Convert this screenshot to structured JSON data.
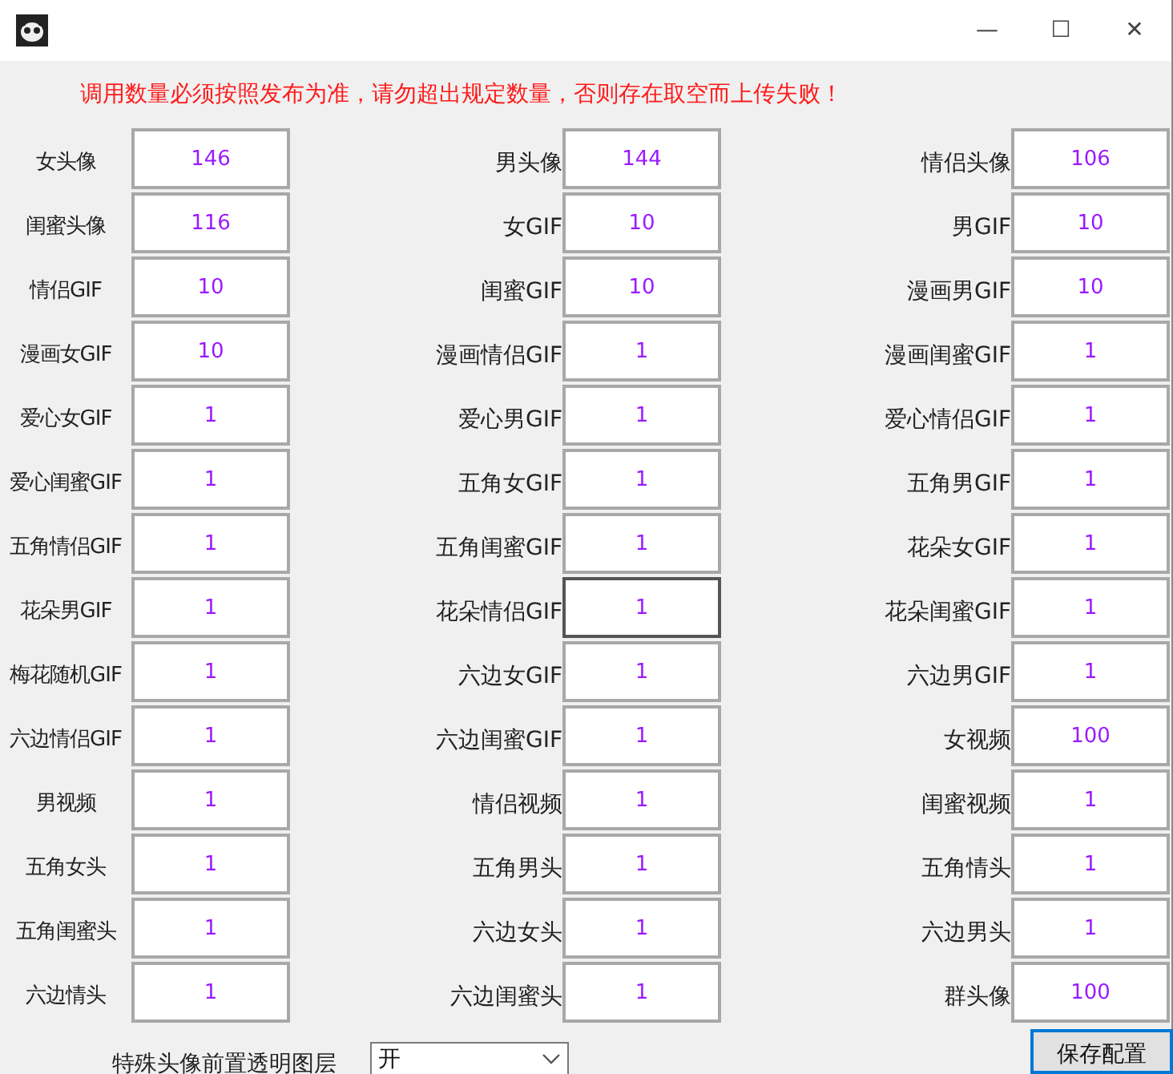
{
  "window": {
    "controls": [
      "—",
      "☐",
      "✕"
    ]
  },
  "notice": "调用数量必须按照发布为准，请勿超出规定数量，否则存在取空而上传失败！",
  "fields": [
    {
      "label": "女头像",
      "value": "146",
      "focused": false
    },
    {
      "label": "男头像",
      "value": "144",
      "focused": false
    },
    {
      "label": "情侣头像",
      "value": "106",
      "focused": false
    },
    {
      "label": "闺蜜头像",
      "value": "116",
      "focused": false
    },
    {
      "label": "女GIF",
      "value": "10",
      "focused": false
    },
    {
      "label": "男GIF",
      "value": "10",
      "focused": false
    },
    {
      "label": "情侣GIF",
      "value": "10",
      "focused": false
    },
    {
      "label": "闺蜜GIF",
      "value": "10",
      "focused": false
    },
    {
      "label": "漫画男GIF",
      "value": "10",
      "focused": false
    },
    {
      "label": "漫画女GIF",
      "value": "10",
      "focused": false
    },
    {
      "label": "漫画情侣GIF",
      "value": "1",
      "focused": false
    },
    {
      "label": "漫画闺蜜GIF",
      "value": "1",
      "focused": false
    },
    {
      "label": "爱心女GIF",
      "value": "1",
      "focused": false
    },
    {
      "label": "爱心男GIF",
      "value": "1",
      "focused": false
    },
    {
      "label": "爱心情侣GIF",
      "value": "1",
      "focused": false
    },
    {
      "label": "爱心闺蜜GIF",
      "value": "1",
      "focused": false
    },
    {
      "label": "五角女GIF",
      "value": "1",
      "focused": false
    },
    {
      "label": "五角男GIF",
      "value": "1",
      "focused": false
    },
    {
      "label": "五角情侣GIF",
      "value": "1",
      "focused": false
    },
    {
      "label": "五角闺蜜GIF",
      "value": "1",
      "focused": false
    },
    {
      "label": "花朵女GIF",
      "value": "1",
      "focused": false
    },
    {
      "label": "花朵男GIF",
      "value": "1",
      "focused": false
    },
    {
      "label": "花朵情侣GIF",
      "value": "1",
      "focused": true
    },
    {
      "label": "花朵闺蜜GIF",
      "value": "1",
      "focused": false
    },
    {
      "label": "梅花随机GIF",
      "value": "1",
      "focused": false
    },
    {
      "label": "六边女GIF",
      "value": "1",
      "focused": false
    },
    {
      "label": "六边男GIF",
      "value": "1",
      "focused": false
    },
    {
      "label": "六边情侣GIF",
      "value": "1",
      "focused": false
    },
    {
      "label": "六边闺蜜GIF",
      "value": "1",
      "focused": false
    },
    {
      "label": "女视频",
      "value": "100",
      "focused": false
    },
    {
      "label": "男视频",
      "value": "1",
      "focused": false
    },
    {
      "label": "情侣视频",
      "value": "1",
      "focused": false
    },
    {
      "label": "闺蜜视频",
      "value": "1",
      "focused": false
    },
    {
      "label": "五角女头",
      "value": "1",
      "focused": false
    },
    {
      "label": "五角男头",
      "value": "1",
      "focused": false
    },
    {
      "label": "五角情头",
      "value": "1",
      "focused": false
    },
    {
      "label": "五角闺蜜头",
      "value": "1",
      "focused": false
    },
    {
      "label": "六边女头",
      "value": "1",
      "focused": false
    },
    {
      "label": "六边男头",
      "value": "1",
      "focused": false
    },
    {
      "label": "六边情头",
      "value": "1",
      "focused": false
    },
    {
      "label": "六边闺蜜头",
      "value": "1",
      "focused": false
    },
    {
      "label": "群头像",
      "value": "100",
      "focused": false
    }
  ],
  "overlay_setting": {
    "label": "特殊头像前置透明图层",
    "value": "开"
  },
  "save_button": {
    "label": "保存配置",
    "focused": true
  }
}
